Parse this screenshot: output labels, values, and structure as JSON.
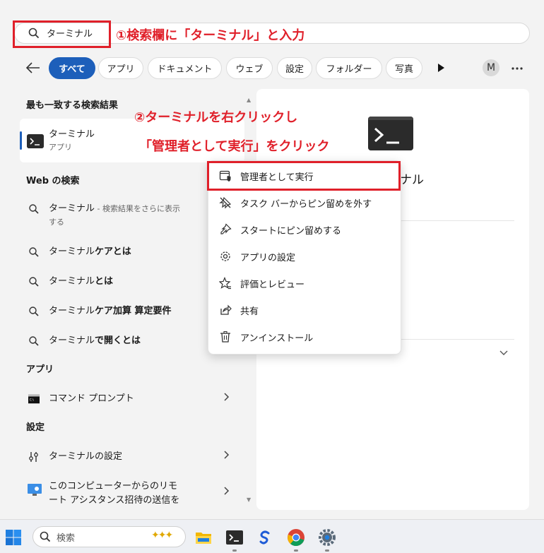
{
  "search": {
    "query": "ターミナル"
  },
  "annotations": {
    "step1": "①検索欄に「ターミナル」と入力",
    "step2_line1": "②ターミナルを右クリックし",
    "step2_line2": "「管理者として実行」をクリック"
  },
  "filters": {
    "items": [
      "すべて",
      "アプリ",
      "ドキュメント",
      "ウェブ",
      "設定",
      "フォルダー",
      "写真"
    ],
    "active": "すべて",
    "avatar": "M"
  },
  "best_match": {
    "heading": "最も一致する検索結果",
    "title": "ターミナル",
    "subtitle": "アプリ"
  },
  "web": {
    "heading": "Web の検索",
    "r1_main": "ターミナル",
    "r1_sub": " - 検索結果をさらに表示",
    "r1_sub2": "する",
    "r2_a": "ターミナル",
    "r2_b": "ケアとは",
    "r3_a": "ターミナル",
    "r3_b": "とは",
    "r4_a": "ターミナル",
    "r4_b": "ケア加算 算定要件",
    "r5_a": "ターミナル",
    "r5_b": "で開くとは"
  },
  "apps": {
    "heading": "アプリ",
    "item": "コマンド プロンプト"
  },
  "settings": {
    "heading": "設定",
    "item1": "ターミナルの設定",
    "item2_l1": "このコンピューターからのリモ",
    "item2_l2": "ート アシスタンス招待の送信を"
  },
  "right_pane": {
    "title_partial": "ナル"
  },
  "context_menu": [
    {
      "label": "管理者として実行",
      "icon": "shield-window-icon"
    },
    {
      "label": "タスク バーからピン留めを外す",
      "icon": "unpin-icon"
    },
    {
      "label": "スタートにピン留めする",
      "icon": "pin-icon"
    },
    {
      "label": "アプリの設定",
      "icon": "gear-icon"
    },
    {
      "label": "評価とレビュー",
      "icon": "star-review-icon"
    },
    {
      "label": "共有",
      "icon": "share-icon"
    },
    {
      "label": "アンインストール",
      "icon": "trash-icon"
    }
  ],
  "taskbar": {
    "search_placeholder": "検索"
  },
  "colors": {
    "accent": "#1d5fba",
    "annotation": "#e0202a"
  }
}
